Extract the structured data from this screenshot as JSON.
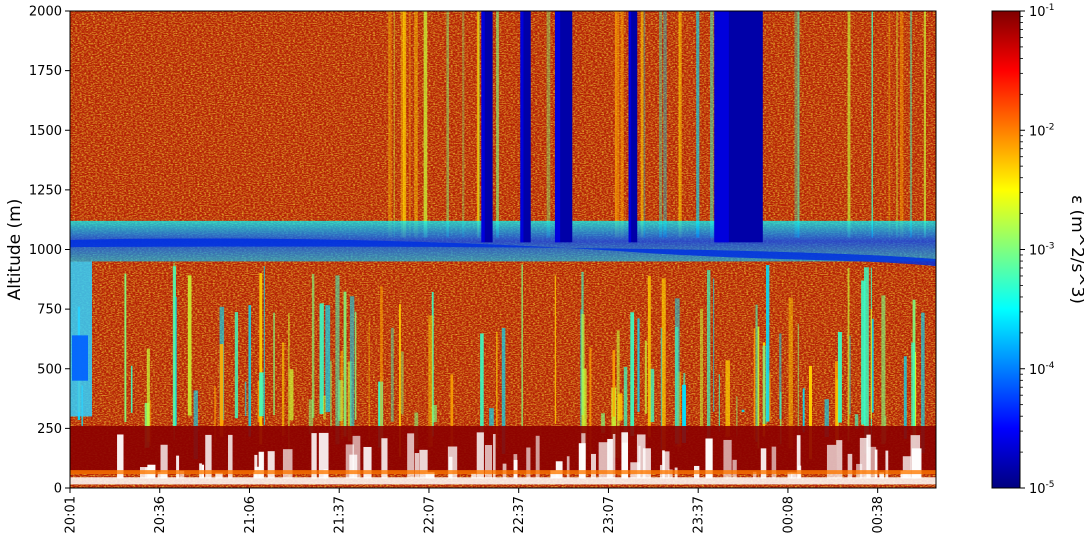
{
  "chart_data": {
    "type": "heatmap",
    "title": "",
    "xlabel": "",
    "ylabel": "Altitude (m)",
    "x_tick_labels": [
      "20:01",
      "20:36",
      "21:06",
      "21:37",
      "22:07",
      "22:37",
      "23:07",
      "23:37",
      "00:08",
      "00:38"
    ],
    "y_ticks": [
      0,
      250,
      500,
      750,
      1000,
      1250,
      1500,
      1750,
      2000
    ],
    "ylim": [
      0,
      2000
    ],
    "colorbar": {
      "label": "ε (m^2/s^3)",
      "scale": "log",
      "range": [
        1e-05,
        0.1
      ],
      "tick_values": [
        1e-05,
        0.0001,
        0.001,
        0.01,
        0.1
      ],
      "tick_mantissa": "10",
      "tick_exponents": [
        "-5",
        "-4",
        "-3",
        "-2",
        "-1"
      ],
      "colormap": "jet"
    },
    "features": {
      "boundary_layer_top_m": [
        1000,
        1120
      ],
      "missing_data_below_m": 250,
      "low_turbulence_columns": [
        "22:22",
        "22:40",
        "22:47",
        "23:30",
        "23:44"
      ]
    },
    "grid": false,
    "legend": "colorbar-right"
  }
}
